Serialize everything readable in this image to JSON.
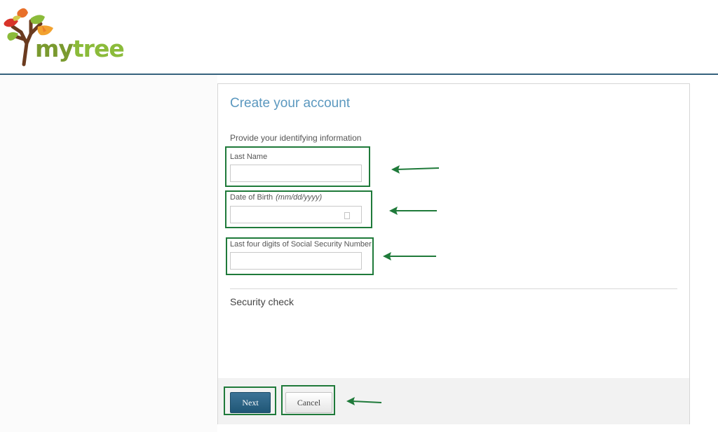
{
  "brand": {
    "logo_my": "my",
    "logo_tree": "tree"
  },
  "form": {
    "title": "Create your account",
    "subtitle": "Provide your identifying information",
    "fields": {
      "last_name": {
        "label": "Last Name",
        "value": ""
      },
      "dob": {
        "label": "Date of Birth",
        "hint": "(mm/dd/yyyy)",
        "value": ""
      },
      "ssn_last4": {
        "label": "Last four digits of Social Security Number",
        "value": ""
      }
    },
    "security_title": "Security check",
    "buttons": {
      "next": "Next",
      "cancel": "Cancel"
    }
  },
  "colors": {
    "header_rule": "#35627d",
    "title": "#5b98bf",
    "primary_button": "#2a6185",
    "annotation": "#1f7a3a"
  }
}
